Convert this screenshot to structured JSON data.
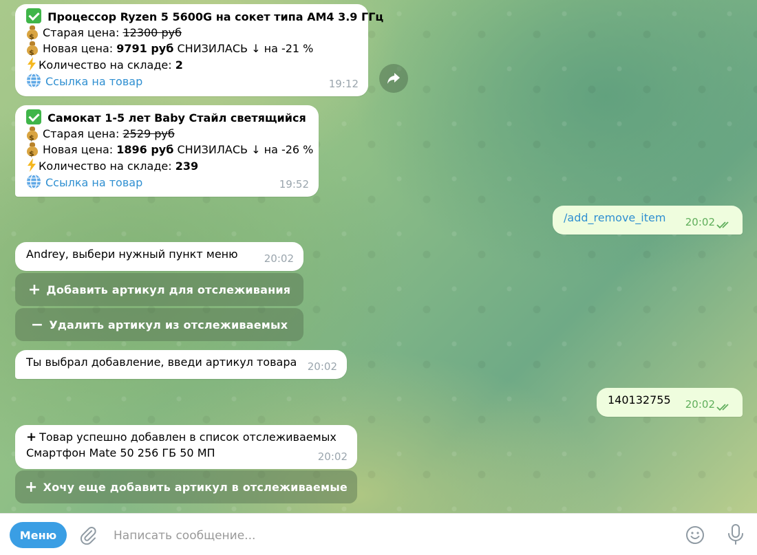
{
  "messages": {
    "m1": {
      "title": "Процессор Ryzen 5 5600G на сокет типа AM4 3.9 ГГц",
      "old_label": "Старая цена:",
      "old_price": "12300 руб",
      "new_label": "Новая цена:",
      "new_price": "9791 руб",
      "change": "СНИЗИЛАСЬ ↓ на -21 %",
      "stock_label": "Количество на складе:",
      "stock": "2",
      "link": "Ссылка на товар",
      "time": "19:12"
    },
    "m2": {
      "title": "Самокат 1-5 лет Baby Стайл светящийся",
      "old_label": "Старая цена:",
      "old_price": "2529 руб",
      "new_label": "Новая цена:",
      "new_price": "1896 руб",
      "change": "СНИЗИЛАСЬ ↓ на -26 %",
      "stock_label": "Количество на складе:",
      "stock": "239",
      "link": "Ссылка на товар",
      "time": "19:52"
    },
    "m3": {
      "text": "/add_remove_item",
      "time": "20:02"
    },
    "m4": {
      "text": "Andrey,  выбери нужный пункт меню",
      "time": "20:02",
      "buttons": [
        "Добавить артикул для отслеживания",
        "Удалить артикул из отслеживаемых"
      ]
    },
    "m5": {
      "text": "Ты выбрал добавление, введи артикул товара",
      "time": "20:02"
    },
    "m6": {
      "text": "140132755",
      "time": "20:02"
    },
    "m7": {
      "line1": "Товар успешно добавлен в список отслеживаемых",
      "line2": "Смартфон Mate 50 256 ГБ 50 МП",
      "time": "20:02",
      "button": "Хочу еще добавить артикул в отслеживаемые"
    }
  },
  "composer": {
    "menu_label": "Меню",
    "placeholder": "Написать сообщение..."
  },
  "colors": {
    "accent": "#3a9ee4",
    "link": "#2f8fd1",
    "outgoing_bubble": "#effdde",
    "read_ticks": "#5fae5b"
  }
}
